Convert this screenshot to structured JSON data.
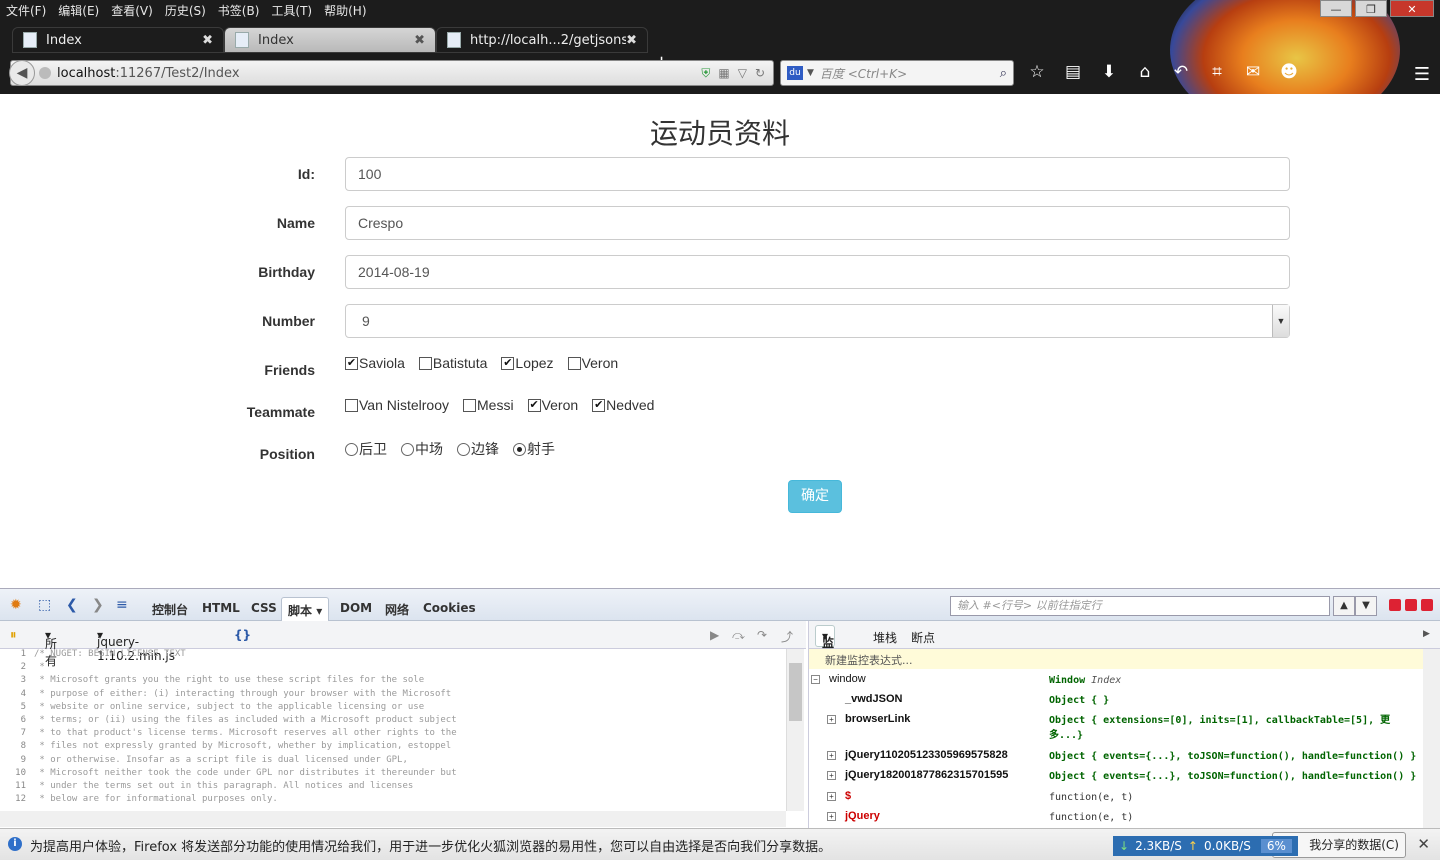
{
  "menubar": [
    "文件(F)",
    "编辑(E)",
    "查看(V)",
    "历史(S)",
    "书签(B)",
    "工具(T)",
    "帮助(H)"
  ],
  "tabs": [
    {
      "label": "Index"
    },
    {
      "label": "Index"
    },
    {
      "label": "http://localh...2/getjsonstr"
    }
  ],
  "url": {
    "host": "localhost",
    "rest": ":11267/Test2/Index"
  },
  "search": {
    "placeholder": "百度 <Ctrl+K>"
  },
  "page": {
    "title": "运动员资料",
    "fields": {
      "id": {
        "label": "Id:",
        "value": "100"
      },
      "name": {
        "label": "Name",
        "value": "Crespo"
      },
      "birthday": {
        "label": "Birthday",
        "value": "2014-08-19"
      },
      "number": {
        "label": "Number",
        "value": "9"
      }
    },
    "friends": {
      "label": "Friends",
      "options": [
        {
          "text": "Saviola",
          "checked": true
        },
        {
          "text": "Batistuta",
          "checked": false
        },
        {
          "text": "Lopez",
          "checked": true
        },
        {
          "text": "Veron",
          "checked": false
        }
      ]
    },
    "teammate": {
      "label": "Teammate",
      "options": [
        {
          "text": "Van Nistelrooy",
          "checked": false
        },
        {
          "text": "Messi",
          "checked": false
        },
        {
          "text": "Veron",
          "checked": true
        },
        {
          "text": "Nedved",
          "checked": true
        }
      ]
    },
    "position": {
      "label": "Position",
      "options": [
        {
          "text": "后卫",
          "checked": false
        },
        {
          "text": "中场",
          "checked": false
        },
        {
          "text": "边锋",
          "checked": false
        },
        {
          "text": "射手",
          "checked": true
        }
      ]
    },
    "submit_label": "确定"
  },
  "firebug": {
    "tabs": [
      "控制台",
      "HTML",
      "CSS",
      "脚本",
      "DOM",
      "网络",
      "Cookies"
    ],
    "search_placeholder": "输入 #<行号> 以前往指定行",
    "filter": "所有",
    "file": "jquery-1.10.2.min.js",
    "braces": "{}",
    "code_lines": [
      "/* NUGET: BEGIN LICENSE TEXT",
      " *",
      " * Microsoft grants you the right to use these script files for the sole",
      " * purpose of either: (i) interacting through your browser with the Microsoft",
      " * website or online service, subject to the applicable licensing or use",
      " * terms; or (ii) using the files as included with a Microsoft product subject",
      " * to that product's license terms. Microsoft reserves all other rights to the",
      " * files not expressly granted by Microsoft, whether by implication, estoppel",
      " * or otherwise. Insofar as a script file is dual licensed under GPL,",
      " * Microsoft neither took the code under GPL nor distributes it thereunder but",
      " * under the terms set out in this paragraph. All notices and licenses",
      " * below are for informational purposes only."
    ],
    "watch_tabs": [
      "监控",
      "堆栈",
      "断点"
    ],
    "new_watch": "新建监控表达式...",
    "watch_rows": [
      {
        "name": "window",
        "value": "Window",
        "extra": "Index"
      },
      {
        "name": "_vwdJSON",
        "value": "Object { }"
      },
      {
        "name": "browserLink",
        "value": "Object { extensions=[0], inits=[1], callbackTable=[5], 更多...}"
      },
      {
        "name": "jQuery110205123305969575828",
        "value": "Object { events={...}, toJSON=function(), handle=function() }"
      },
      {
        "name": "jQuery182001877862315701595",
        "value": "Object { events={...}, toJSON=function(), handle=function() }"
      },
      {
        "name": "$",
        "value": "function(e, t)"
      },
      {
        "name": "jQuery",
        "value": "function(e, t)"
      }
    ]
  },
  "notification": {
    "message": "为提高用户体验，Firefox 将发送部分功能的使用情况给我们，用于进一步优化火狐浏览器的易用性，您可以自由选择是否向我们分享数据。",
    "button": "我分享的数据(C)",
    "down_speed": "2.3KB/S",
    "up_speed": "0.0KB/S",
    "percent": "6%"
  },
  "colors": {
    "submit": "#5bc0de",
    "chrome": "#1c1c1c",
    "watch_object": "#006400"
  }
}
